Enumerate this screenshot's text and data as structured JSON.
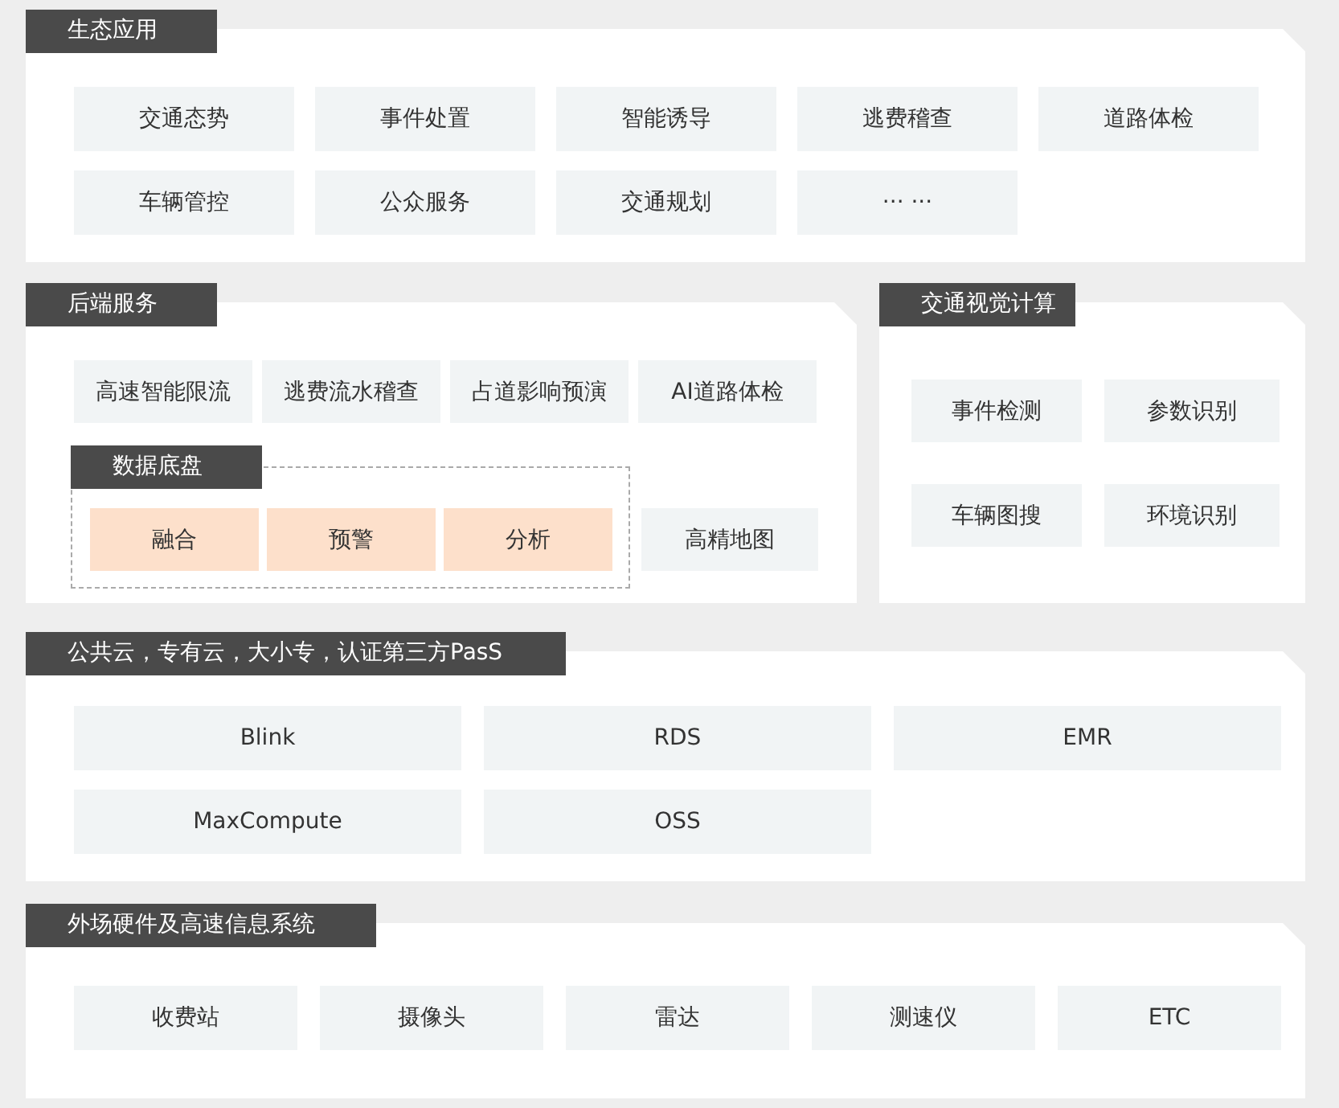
{
  "ecosystem_apps": {
    "title": "生态应用",
    "tiles": [
      "交通态势",
      "事件处置",
      "智能诱导",
      "逃费稽查",
      "道路体检",
      "车辆管控",
      "公众服务",
      "交通规划",
      "··· ···"
    ]
  },
  "backend_services": {
    "title": "后端服务",
    "tiles": [
      "高速智能限流",
      "逃费流水稽查",
      "占道影响预演",
      "AI道路体检"
    ],
    "data_platform": {
      "title": "数据底盘",
      "tiles": [
        "融合",
        "预警",
        "分析"
      ]
    },
    "hd_map": "高精地图"
  },
  "vision_computing": {
    "title": "交通视觉计算",
    "tiles": [
      "事件检测",
      "参数识别",
      "车辆图搜",
      "环境识别"
    ]
  },
  "cloud": {
    "title": "公共云，专有云，大小专，认证第三方PasS",
    "tiles": [
      "Blink",
      "RDS",
      "EMR",
      "MaxCompute",
      "OSS"
    ]
  },
  "field_hardware": {
    "title": "外场硬件及高速信息系统",
    "tiles": [
      "收费站",
      "摄像头",
      "雷达",
      "测速仪",
      "ETC"
    ]
  }
}
